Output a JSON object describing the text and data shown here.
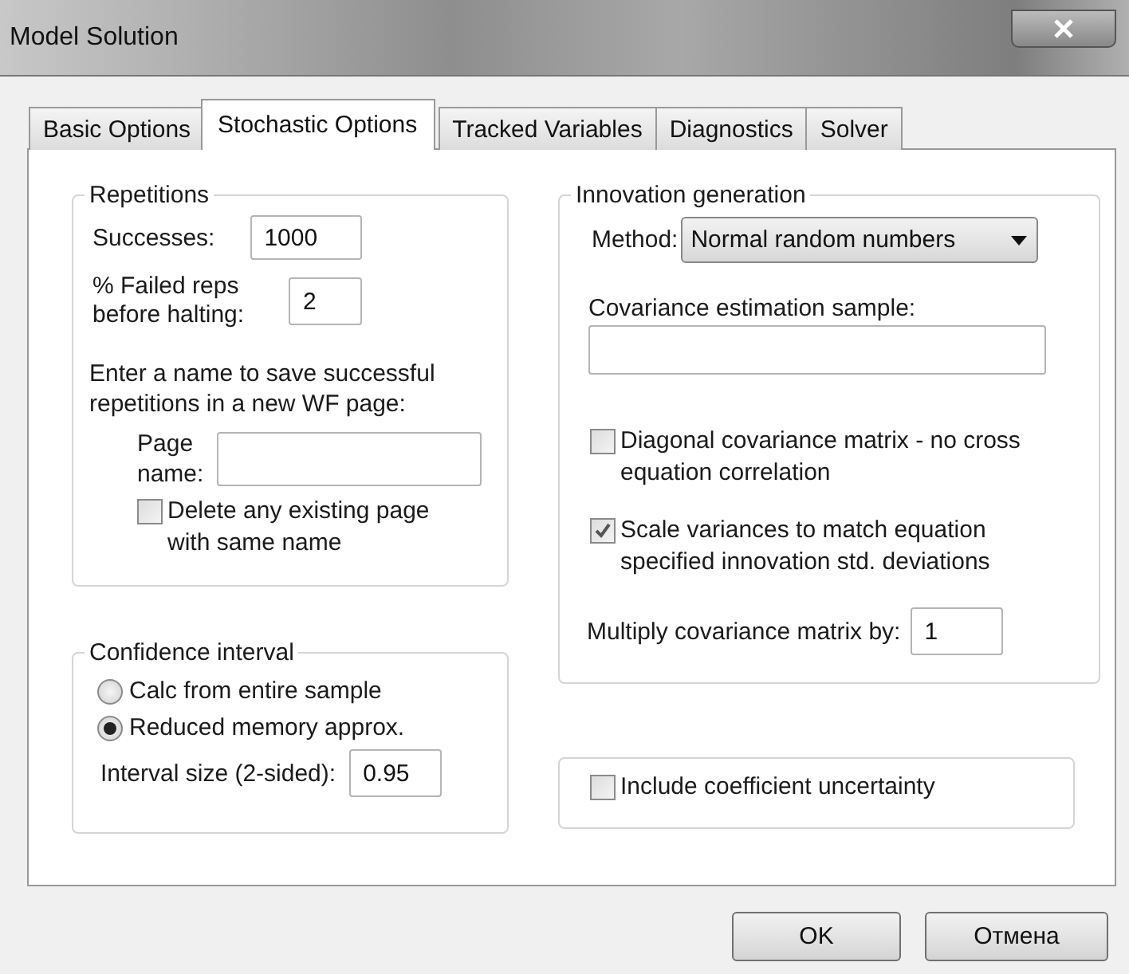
{
  "window": {
    "title": "Model Solution"
  },
  "tabs": [
    {
      "label": "Basic Options",
      "selected": false
    },
    {
      "label": "Stochastic Options",
      "selected": true
    },
    {
      "label": "Tracked Variables",
      "selected": false
    },
    {
      "label": "Diagnostics",
      "selected": false
    },
    {
      "label": "Solver",
      "selected": false
    }
  ],
  "repetitions": {
    "title": "Repetitions",
    "successes": {
      "label": "Successes:",
      "value": "1000"
    },
    "failed_reps": {
      "label": "% Failed reps before halting:",
      "value": "2"
    },
    "save_note": "Enter a name to save successful repetitions in a new WF page:",
    "page_name": {
      "label": "Page name:"
    },
    "delete_existing": {
      "label": "Delete any existing page with same name",
      "checked": false
    }
  },
  "confidence_interval": {
    "title": "Confidence interval",
    "options": [
      {
        "label": "Calc from entire sample",
        "selected": false
      },
      {
        "label": "Reduced memory approx.",
        "selected": true
      }
    ],
    "interval_size": {
      "label": "Interval size (2-sided):",
      "value": "0.95"
    }
  },
  "innovation_generation": {
    "title": "Innovation generation",
    "method": {
      "label": "Method:",
      "value": "Normal random numbers"
    },
    "covariance_sample": {
      "label": "Covariance estimation sample:"
    },
    "options": [
      {
        "label": "Diagonal covariance matrix - no cross equation correlation",
        "checked": false
      },
      {
        "label": "Scale variances to match equation specified innovation std. deviations",
        "checked": true
      }
    ],
    "multiply": {
      "label": "Multiply covariance matrix by:",
      "value": "1"
    }
  },
  "coefficient_uncertainty": {
    "label": "Include coefficient uncertainty",
    "checked": false
  },
  "buttons": [
    "OK",
    "Отмена"
  ]
}
